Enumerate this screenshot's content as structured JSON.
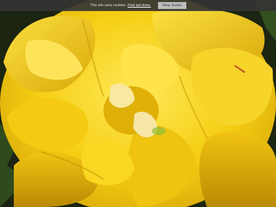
{
  "cookie_bar": {
    "message": "This site uses cookies.",
    "link_text": "Find out more.",
    "button_label": "Okay, thanks"
  },
  "photo": {
    "subject": "yellow-tulip-flower",
    "colors": {
      "petal_main": "#f5d21a",
      "petal_light": "#ffe85a",
      "petal_shadow": "#c99a05",
      "background": "#1c2412"
    }
  }
}
